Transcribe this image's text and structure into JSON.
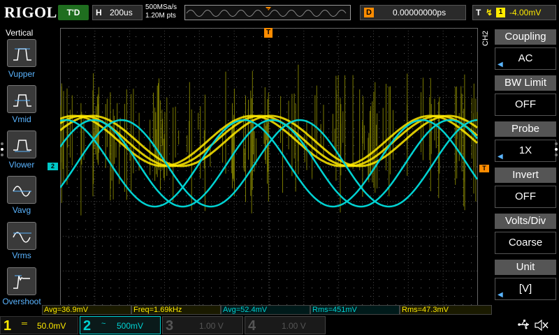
{
  "brand": {
    "logo": "RIGOL"
  },
  "status": {
    "run_state": "T'D"
  },
  "timebase": {
    "label": "H",
    "value": "200us"
  },
  "acquisition": {
    "sample_rate": "500MSa/s",
    "points": "1.20M pts"
  },
  "delay": {
    "label": "D",
    "value": "0.00000000ps"
  },
  "trigger": {
    "label": "T",
    "edge_icon": "rising-edge-icon",
    "source": "1",
    "level": "-4.00mV",
    "marker": "T"
  },
  "left_menu": {
    "title": "Vertical",
    "items": [
      {
        "label": "Vupper",
        "icon": "vupper-icon"
      },
      {
        "label": "Vmid",
        "icon": "vmid-icon"
      },
      {
        "label": "Vlower",
        "icon": "vlower-icon"
      },
      {
        "label": "Vavg",
        "icon": "vavg-icon"
      },
      {
        "label": "Vrms",
        "icon": "vrms-icon"
      },
      {
        "label": "Overshoot",
        "icon": "overshoot-icon"
      }
    ]
  },
  "right_menu": {
    "channel_tag": "CH2",
    "items": [
      {
        "title": "Coupling",
        "value": "AC",
        "has_arrow": true
      },
      {
        "title": "BW Limit",
        "value": "OFF",
        "has_arrow": false
      },
      {
        "title": "Probe",
        "value": "1X",
        "has_arrow": true
      },
      {
        "title": "Invert",
        "value": "OFF",
        "has_arrow": false
      },
      {
        "title": "Volts/Div",
        "value": "Coarse",
        "has_arrow": false
      },
      {
        "title": "Unit",
        "value": "[V]",
        "has_arrow": true
      }
    ]
  },
  "markers": {
    "ch2": "2"
  },
  "measurements": [
    {
      "text": "Avg=36.9mV",
      "channel": 1
    },
    {
      "text": "Freq=1.69kHz",
      "channel": 1
    },
    {
      "text": "Avg=52.4mV",
      "channel": 2
    },
    {
      "text": "Rms=451mV",
      "channel": 2
    },
    {
      "text": "Rms=47.3mV",
      "channel": 1
    }
  ],
  "channels": [
    {
      "num": "1",
      "coupling": "═",
      "scale": "50.0mV",
      "color": "#ffea00"
    },
    {
      "num": "2",
      "coupling": "~",
      "scale": "500mV",
      "color": "#00d2d2"
    },
    {
      "num": "3",
      "coupling": "",
      "scale": "1.00 V",
      "color": "#c03ac0"
    },
    {
      "num": "4",
      "coupling": "",
      "scale": "1.00 V",
      "color": "#3a6ad0"
    }
  ],
  "colors": {
    "ch1": "#ffea00",
    "ch2": "#00d2d2",
    "trigger": "#ff8c00",
    "accent": "#5ab4ff"
  },
  "icons": {
    "usb": "usb-icon",
    "speaker": "speaker-muted-icon"
  }
}
